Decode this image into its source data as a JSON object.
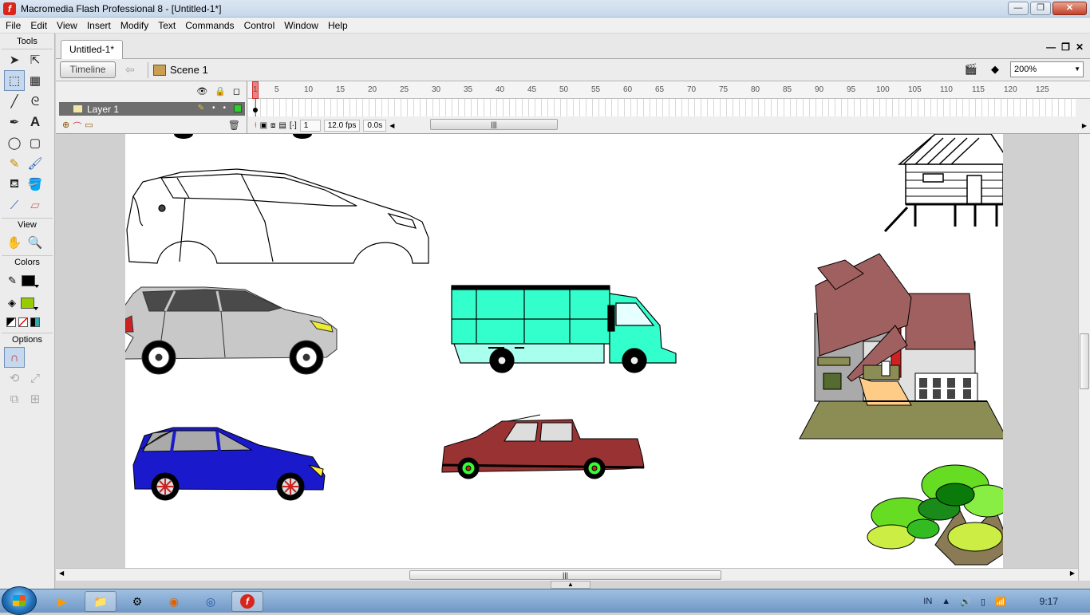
{
  "window": {
    "title": "Macromedia Flash Professional 8 - [Untitled-1*]",
    "app_icon": "flash-icon",
    "controls": {
      "minimize": "—",
      "maximize": "❐",
      "close": "✕"
    }
  },
  "menu": [
    "File",
    "Edit",
    "View",
    "Insert",
    "Modify",
    "Text",
    "Commands",
    "Control",
    "Window",
    "Help"
  ],
  "tools": {
    "header": "Tools",
    "view_label": "View",
    "colors_label": "Colors",
    "options_label": "Options",
    "stroke_color": "#000000",
    "fill_color": "#99cc00"
  },
  "document": {
    "tab": "Untitled-1*",
    "controls": {
      "minimize": "—",
      "restore": "❐",
      "close": "✕"
    },
    "timeline_button": "Timeline",
    "scene": "Scene 1",
    "zoom": "200%"
  },
  "timeline": {
    "ruler": [
      "1",
      "5",
      "10",
      "15",
      "20",
      "25",
      "30",
      "35",
      "40",
      "45",
      "50",
      "55",
      "60",
      "65",
      "70",
      "75",
      "80",
      "85",
      "90",
      "95",
      "100",
      "105",
      "110",
      "115",
      "120",
      "125"
    ],
    "layer_name": "Layer 1",
    "current_frame": "1",
    "frame_rate": "12.0 fps",
    "elapsed": "0.0s",
    "scroll_grip": "|||"
  },
  "stage": {
    "scroll_grip": "|||",
    "colors": {
      "blue_car": "#1a1acc",
      "silver_car": "#c8c8c8",
      "truck_cyan": "#33ffcc",
      "pickup_red": "#993333",
      "house_roof": "#a06060",
      "tree_green": "#66dd22"
    }
  },
  "taskbar": {
    "tray_lang": "IN",
    "clock": "9:17"
  }
}
